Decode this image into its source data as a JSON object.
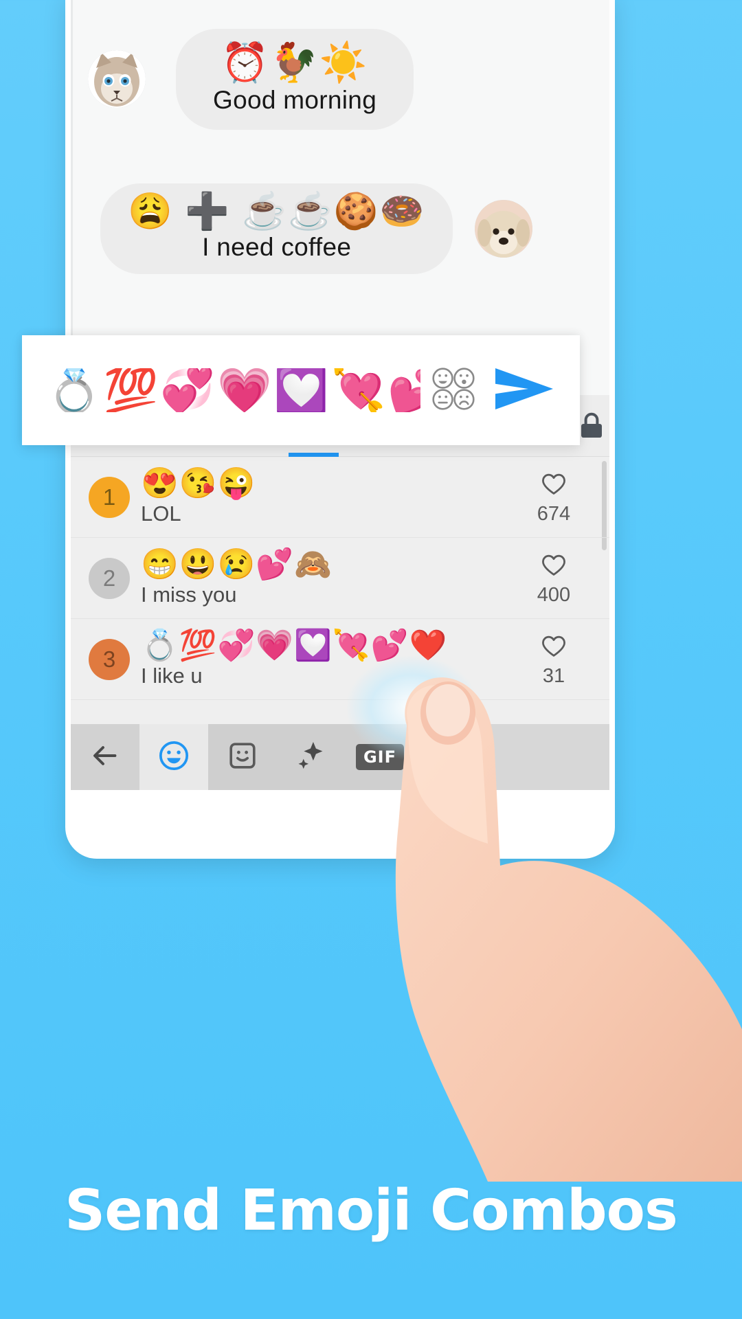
{
  "chat": {
    "messages": [
      {
        "avatar_icon": "cat-avatar",
        "emojis": "⏰🐓☀️",
        "text": "Good morning"
      },
      {
        "avatar_icon": "dog-avatar",
        "emojis": "😩 ➕ ☕☕🍪🍩",
        "text": "I need coffee"
      }
    ]
  },
  "input_bar": {
    "composed_emojis": "💍💯💞💗💟💘💕❤️",
    "emoji_grid_icon": "emoji-grid-icon",
    "send_icon": "send-icon",
    "send_color": "#2196f3"
  },
  "panel": {
    "tabs": [
      {
        "name": "recent",
        "icon": "clock-icon",
        "active": false
      },
      {
        "name": "smileys",
        "icon": "smiley-icon",
        "active": false
      },
      {
        "name": "hearts",
        "icon": "heart-icon",
        "active": false
      },
      {
        "name": "trending",
        "icon": "trending-icon",
        "active": true
      },
      {
        "name": "nature",
        "icon": "flower-icon",
        "active": false
      },
      {
        "name": "food",
        "icon": "coffee-icon",
        "active": false
      },
      {
        "name": "sports",
        "icon": "ball-icon",
        "active": false
      },
      {
        "name": "objects",
        "icon": "lock-icon",
        "active": false
      }
    ],
    "active_tab_color": "#2196f3",
    "rows": [
      {
        "rank": "1",
        "rank_style": "gold",
        "emojis": "😍😘😜",
        "label": "LOL",
        "likes": "674",
        "like_icon": "heart-outline-icon"
      },
      {
        "rank": "2",
        "rank_style": "silver",
        "emojis": "😁😃😢💕🙈",
        "label": "I miss you",
        "likes": "400",
        "like_icon": "heart-outline-icon"
      },
      {
        "rank": "3",
        "rank_style": "bronze",
        "emojis": "💍💯💞💗💟💘💕❤️",
        "label": "I like u",
        "likes": "31",
        "like_icon": "heart-outline-icon"
      }
    ]
  },
  "bottom_bar": {
    "items": [
      {
        "name": "back",
        "icon": "back-arrow-icon",
        "active": false,
        "label": ""
      },
      {
        "name": "emoji",
        "icon": "emoji-icon",
        "active": true,
        "label": ""
      },
      {
        "name": "sticker",
        "icon": "sticker-icon",
        "active": false,
        "label": ""
      },
      {
        "name": "sparkle",
        "icon": "sparkle-icon",
        "active": false,
        "label": ""
      },
      {
        "name": "gif",
        "icon": "gif-icon",
        "active": false,
        "label": "GIF"
      }
    ]
  },
  "headline": {
    "text": "Send Emoji Combos"
  },
  "theme": {
    "background": "#57c9fb",
    "accent": "#2196f3",
    "headline_color": "#ffffff"
  }
}
